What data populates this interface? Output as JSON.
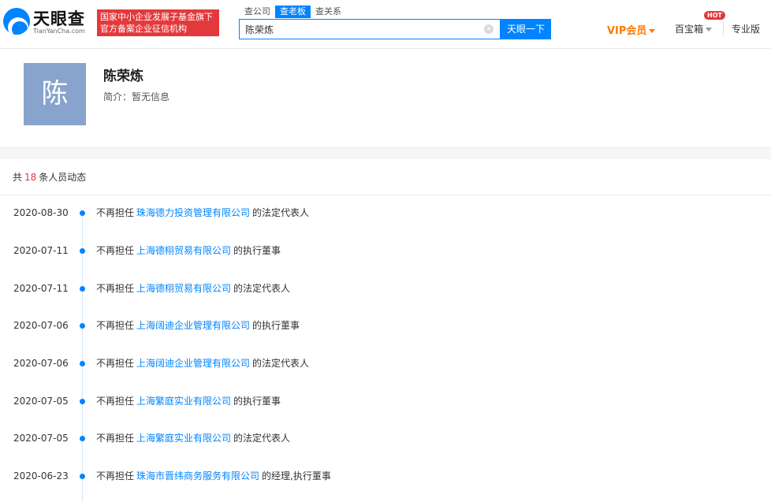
{
  "header": {
    "logo_text": "天眼查",
    "logo_sub": "TianYanCha.com",
    "org_line1": "国家中小企业发展子基金旗下",
    "org_line2": "官方备案企业征信机构",
    "search_tabs": [
      {
        "label": "查公司",
        "active": false
      },
      {
        "label": "查老板",
        "active": true
      },
      {
        "label": "查关系",
        "active": false
      }
    ],
    "search_value": "陈荣炼",
    "search_clear": "×",
    "search_button": "天眼一下",
    "vip_label": "VIP会员",
    "toolbox_label": "百宝箱",
    "hot_badge": "HOT",
    "pro_label": "专业版"
  },
  "profile": {
    "avatar_char": "陈",
    "name": "陈荣炼",
    "intro_label": "简介：",
    "intro_value": "暂无信息"
  },
  "list": {
    "prefix": "共",
    "count": "18",
    "suffix": "条人员动态",
    "rows": [
      {
        "date": "2020-08-30",
        "pre": "不再担任",
        "company": "珠海德力投资管理有限公司",
        "post": "的法定代表人"
      },
      {
        "date": "2020-07-11",
        "pre": "不再担任",
        "company": "上海德栩贸易有限公司",
        "post": "的执行董事"
      },
      {
        "date": "2020-07-11",
        "pre": "不再担任",
        "company": "上海德栩贸易有限公司",
        "post": "的法定代表人"
      },
      {
        "date": "2020-07-06",
        "pre": "不再担任",
        "company": "上海阔迪企业管理有限公司",
        "post": "的执行董事"
      },
      {
        "date": "2020-07-06",
        "pre": "不再担任",
        "company": "上海阔迪企业管理有限公司",
        "post": "的法定代表人"
      },
      {
        "date": "2020-07-05",
        "pre": "不再担任",
        "company": "上海繁庭实业有限公司",
        "post": "的执行董事"
      },
      {
        "date": "2020-07-05",
        "pre": "不再担任",
        "company": "上海繁庭实业有限公司",
        "post": "的法定代表人"
      },
      {
        "date": "2020-06-23",
        "pre": "不再担任",
        "company": "珠海市晋纬商务服务有限公司",
        "post": "的经理,执行董事"
      }
    ]
  },
  "colors": {
    "brand_blue": "#0084ff",
    "badge_red": "#e4393c",
    "vip_orange": "#ff7a00",
    "avatar_bg": "#88a3cc"
  }
}
